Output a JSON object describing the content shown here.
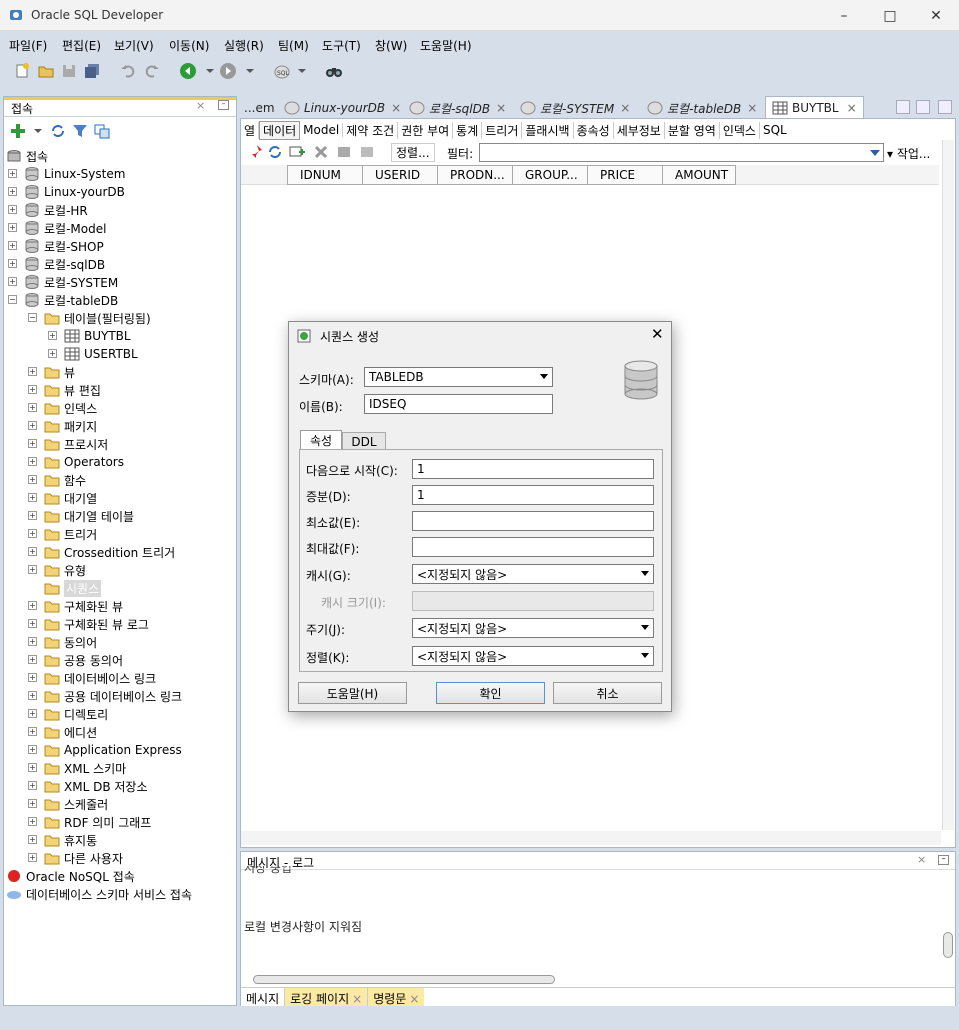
{
  "window": {
    "title": "Oracle SQL Developer"
  },
  "menu": [
    "파일(F)",
    "편집(E)",
    "보기(V)",
    "이동(N)",
    "실행(R)",
    "팀(M)",
    "도구(T)",
    "창(W)",
    "도움말(H)"
  ],
  "left_panel": {
    "title": "접속",
    "root": "접속",
    "connections": [
      "Linux-System",
      "Linux-yourDB",
      "로컬-HR",
      "로컬-Model",
      "로컬-SHOP",
      "로컬-sqlDB",
      "로컬-SYSTEM",
      "로컬-tableDB"
    ],
    "tables_node": "테이블(필터링됨)",
    "tables": [
      "BUYTBL",
      "USERTBL"
    ],
    "nodes": [
      "뷰",
      "뷰 편집",
      "인덱스",
      "패키지",
      "프로시저",
      "Operators",
      "함수",
      "대기열",
      "대기열 테이블",
      "트리거",
      "Crossedition 트리거",
      "유형",
      "시퀀스",
      "구체화된 뷰",
      "구체화된 뷰 로그",
      "동의어",
      "공용 동의어",
      "데이터베이스 링크",
      "공용 데이터베이스 링크",
      "디렉토리",
      "에디션",
      "Application Express",
      "XML 스키마",
      "XML DB 저장소",
      "스케줄러",
      "RDF 의미 그래프",
      "휴지통",
      "다른 사용자"
    ],
    "nosql": "Oracle NoSQL 접속",
    "cloud": "데이터베이스 스키마 서비스 접속"
  },
  "doc_tabs": [
    "...em",
    "Linux-yourDB",
    "로컬-sqlDB",
    "로컬-SYSTEM",
    "로컬-tableDB",
    "BUYTBL"
  ],
  "sub_tabs": [
    "열",
    "데이터",
    "Model",
    "제약 조건",
    "권한 부여",
    "통계",
    "트리거",
    "플래시백",
    "종속성",
    "세부정보",
    "분할 영역",
    "인덱스",
    "SQL"
  ],
  "grid_tools": {
    "sort": "정렬...",
    "filter": "필터:",
    "actions": "작업..."
  },
  "columns": [
    "IDNUM",
    "USERID",
    "PRODN...",
    "GROUP...",
    "PRICE",
    "AMOUNT"
  ],
  "messages": {
    "title": "메시지 - 로그",
    "partial": "저장 중입",
    "text": "로컬 변경사항이 지워짐",
    "tabs": [
      "메시지",
      "로깅 페이지",
      "명령문"
    ]
  },
  "dialog": {
    "title": "시퀀스 생성",
    "schema_label": "스키마(A):",
    "schema_value": "TABLEDB",
    "name_label": "이름(B):",
    "name_value": "IDSEQ",
    "tabs": [
      "속성",
      "DDL"
    ],
    "start_label": "다음으로 시작(C):",
    "start_value": "1",
    "inc_label": "증분(D):",
    "inc_value": "1",
    "min_label": "최소값(E):",
    "max_label": "최대값(F):",
    "cache_label": "캐시(G):",
    "cache_value": "<지정되지 않음>",
    "cache_size_label": "캐시 크기(I):",
    "cycle_label": "주기(J):",
    "cycle_value": "<지정되지 않음>",
    "order_label": "정렬(K):",
    "order_value": "<지정되지 않음>",
    "help": "도움말(H)",
    "ok": "확인",
    "cancel": "취소"
  },
  "colors": {
    "accent": "#d6dfe9",
    "highlight": "#fbe9a6"
  }
}
